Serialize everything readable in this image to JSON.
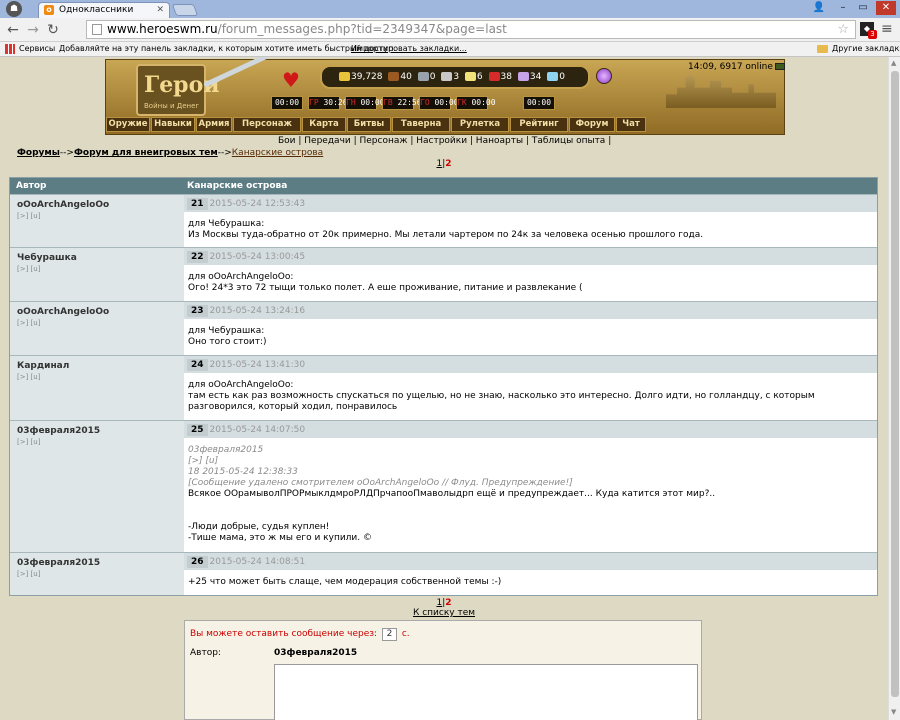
{
  "browser": {
    "tab_title": "Одноклассники",
    "tab_favicon": "ok",
    "url_host": "www.heroeswm.ru",
    "url_path": "/forum_messages.php?tid=2349347&page=last",
    "ext_badge": "3",
    "bookmarks": [
      {
        "label": "Сервисы"
      },
      {
        "label": "Добавляйте на эту панель закладки, к которым хотите иметь быстрый доступ."
      },
      {
        "label": "Импортировать закладки..."
      }
    ],
    "other_bookmarks": "Другие закладки",
    "icons": [
      "chrome-icon",
      "back-icon",
      "forward-icon",
      "reload-icon",
      "star-icon",
      "menu-icon",
      "apps-icon",
      "folder-icon"
    ]
  },
  "game": {
    "logo_main": "Герои",
    "logo_sub": "Войны и Денег",
    "resources": [
      "39,728",
      "40",
      "0",
      "3",
      "6",
      "38",
      "34",
      "0"
    ],
    "timers": [
      {
        "prefix": "",
        "value": "00:00"
      },
      {
        "prefix": "ГР",
        "value": "30:26"
      },
      {
        "prefix": "ГН",
        "value": "00:00"
      },
      {
        "prefix": "ГВ",
        "value": "22:56"
      },
      {
        "prefix": "ГО",
        "value": "00:00"
      },
      {
        "prefix": "ГК",
        "value": "00:00"
      },
      {
        "prefix": "",
        "value": "00:00"
      }
    ],
    "nav": [
      {
        "label": "Оружие",
        "w": 44
      },
      {
        "label": "Навыки",
        "w": 44
      },
      {
        "label": "Армия",
        "w": 36
      },
      {
        "label": "Персонаж",
        "w": 68
      },
      {
        "label": "Карта",
        "w": 44
      },
      {
        "label": "Битвы",
        "w": 44
      },
      {
        "label": "Таверна",
        "w": 58
      },
      {
        "label": "Рулетка",
        "w": 58
      },
      {
        "label": "Рейтинг",
        "w": 58
      },
      {
        "label": "Форум",
        "w": 46
      },
      {
        "label": "Чат",
        "w": 30
      }
    ],
    "clock": "14:09, 6917 online",
    "sublinks": "Бои | Передачи | Персонаж | Настройки | Наноарты | Таблицы опыта |"
  },
  "breadcrumb": {
    "forums": "Форумы",
    "sep1": "-->",
    "section": "Форум для внеигровых тем",
    "sep2": "-->",
    "topic": "Канарские острова"
  },
  "pager": {
    "p1": "1",
    "sep": "|",
    "p2": "2"
  },
  "forum": {
    "col_author": "Автор",
    "col_topic": "Канарские острова",
    "posts": [
      {
        "author": "oOoArchAngeloOo",
        "links": "[>] [u]",
        "num": "21",
        "date": "2015-05-24 12:53:43",
        "height": 53,
        "lines": [
          {
            "t": "для Чебурашка:"
          },
          {
            "t": "Из Москвы туда-обратно от 20к примерно. Мы летали чартером по 24к за человека осенью прошлого года."
          }
        ]
      },
      {
        "author": "Чебурашка",
        "links": "[>] [u]",
        "num": "22",
        "date": "2015-05-24 13:00:45",
        "height": 54,
        "lines": [
          {
            "t": "для oOoArchAngeloOo:"
          },
          {
            "t": "Ого! 24*3 это 72 тыщи только полет. А еше проживание, питание и развлекание ("
          }
        ]
      },
      {
        "author": "oOoArchAngeloOo",
        "links": "[>] [u]",
        "num": "23",
        "date": "2015-05-24 13:24:16",
        "height": 54,
        "lines": [
          {
            "t": "для Чебурашка:"
          },
          {
            "t": "Оно того стоит:)"
          }
        ]
      },
      {
        "author": "Кардинал",
        "links": "[>] [u]",
        "num": "24",
        "date": "2015-05-24 13:41:30",
        "height": 65,
        "lines": [
          {
            "t": "для oOoArchAngeloOo:"
          },
          {
            "t": "там есть как раз возможность спускаться по ущелью, но не знаю, насколько это интересно. Долго идти, но голландцу, с которым"
          },
          {
            "t": "разговорился, который ходил, понравилось"
          }
        ]
      },
      {
        "author": "03февраля2015",
        "links": "[>] [u]",
        "num": "25",
        "date": "2015-05-24 14:07:50",
        "height": 132,
        "lines": [
          {
            "t": "03февраля2015",
            "q": true
          },
          {
            "t": "[>] [u]",
            "q": true
          },
          {
            "t": " 18  2015-05-24 12:38:33",
            "q": true
          },
          {
            "t": "[Сообщение удалено смотрителем oOoArchAngeloOo // Флуд. Предупреждение!]",
            "q": true
          },
          {
            "t": "Всякое ООрамыволПРОРмыклдмроРЛДПрчапооПмаволыдрп ещё и предупреждает... Куда катится этот мир?.."
          },
          {
            "t": ""
          },
          {
            "t": ""
          },
          {
            "t": "-Люди добрые, судья куплен!"
          },
          {
            "t": "-Тише мама, это ж мы его и купили. ©"
          }
        ]
      },
      {
        "author": "03февраля2015",
        "links": "[>] [u]",
        "num": "26",
        "date": "2015-05-24 14:08:51",
        "height": 43,
        "lines": [
          {
            "t": "+25 что может быть слаще, чем модерация собственной темы :-)"
          }
        ]
      }
    ]
  },
  "back_link": "К списку тем",
  "reply": {
    "wait_pre": "Вы можете оставить сообщение через:",
    "wait_val": "2",
    "wait_post": "с.",
    "author_label": "Автор:",
    "author_name": "03февраля2015"
  }
}
